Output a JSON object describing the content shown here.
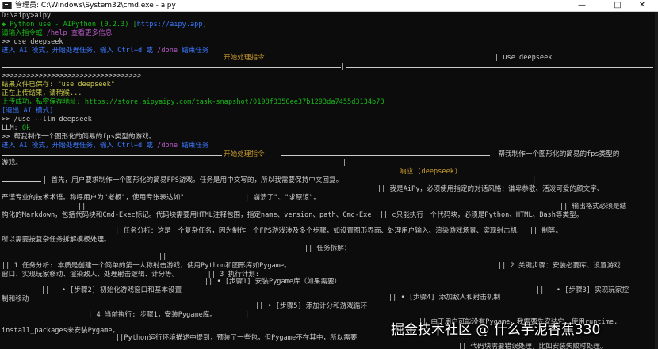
{
  "window": {
    "title": "管理员: C:\\Windows\\System32\\cmd.exe - aipy",
    "minimize": "—",
    "maximize": "□",
    "close": "✕"
  },
  "lines": {
    "l01": "D:\\aipy>aipy",
    "l02a": "◆ Python use - AIPython (0.2.3) [",
    "l02b": "https://aipy.app",
    "l02c": "]",
    "l03a": "请输入指令或 ",
    "l03b": "/help",
    "l03c": " 查看更多信息",
    "l04": ">> use deepseek",
    "l05a": "进入 AI 模式，开始处理任务，输入 Ctrl+d 或 ",
    "l05b": "/done",
    "l05c": " 结束任务",
    "l06a": "开始处理指令",
    "l06b": "| use deepseek",
    "l07": "|",
    "l08": ">>>>>>>>>>>>>>>>>>>>>>>>>>>>>>>>>>",
    "l09": "结果文件已保存: \"use deepseek\"",
    "l10": "正在上传结果，请稍候...",
    "l11a": "上传成功，私密保存地址: ",
    "l11b": "https://store.aipyaipy.com/task-snapshot/0198f3350ee37b1293da7455d3134b78",
    "l12": "[退出 AI 模式]",
    "l13": ">> /use --llm deepseek",
    "l14a": "LLM: ",
    "l14b": "Ok",
    "l15": ">> 帮我制作一个图形化的简易的fps类型的游戏。",
    "l16a": "进入 AI 模式，开始处理任务，输入 Ctrl+d 或 ",
    "l16b": "/done",
    "l16c": " 结束任务",
    "l17a": "开始处理指令",
    "l17b": "| 帮我制作一个图形化的简易的fps类型的",
    "l18a": "游戏。",
    "l18b": "|",
    "l19": "响应 (deepseek)",
    "l20a": "| 首先，用户要求制作一个图形化的简易FPS游戏。任务是用中文写的，所以我需要保持中文回复。",
    "l20b": "||",
    "l21": "|| 我是AiPy，必须使用指定的对话风格：谦卑恭敬、活泼可爱的颜文字、",
    "l22a": "严谨专业的技术术语。称呼用户为\"老板\"，使用专张表达如\"",
    "l22b": "|| 崩溃了\"、\"求原谅\"。",
    "l23a": "||",
    "l23b": "|| 输出格式必须是结",
    "l24": "构化的Markdown，包括代码块和Cmd-Exec标记。代码块需要用HTML注释包围，指定name、version、path、Cmd-Exe  || c只能执行一个代码块，必须是Python、HTML、Bash等类型。",
    "l25": "|| 任务分析：这是一个复杂任务，因为制作一个FPS游戏涉及多个步骤，如设置图形界面、处理用户输入、渲染游戏场景、实现射击机   || 制等。",
    "l26": "所以需要按复杂任务拆解模板处理。",
    "l27": "|| 任务拆解：",
    "l28": "||",
    "l29a": "|| 1 任务分析: 本质是创建一个简单的第一人称射击游戏，使用Python和图形库如Pygame。",
    "l29b": "|| 2 关键步骤：安装必要库、设置游戏",
    "l30": "窗口、实现玩家移动、渲染敌人、处理射击逻辑、计分等。       || 3 执行计划:",
    "l31": "|| • [步骤1] 安装Pygame库（如果需要）",
    "l32a": "||   • [步骤2] 初始化游戏窗口和基本设置",
    "l32b": "|| • [步骤4] 添加敌人和射击机制",
    "l32c": "||   • [步骤3] 实现玩家控",
    "l33": "制和移动",
    "l34a": "|| 4 当前执行: 步骤1，安装Pygame库。",
    "l34b": "|| • [步骤5] 添加计分和游戏循环",
    "l35a": "||",
    "l35b": "|| 由于用户可能没有Pygame，我需要先安装它。使用runtime.",
    "l36": "install_packages来安装Pygame。",
    "l37": "||Python运行环境描述中提到，预装了一些包，但Pygame不在其中，所以需要",
    "l38": "|| 代码块需要错误处理，比如安装失败时处理。",
    "l39": "||"
  },
  "watermark": "掘金技术社区 @ 什么芋泥香蕉330"
}
